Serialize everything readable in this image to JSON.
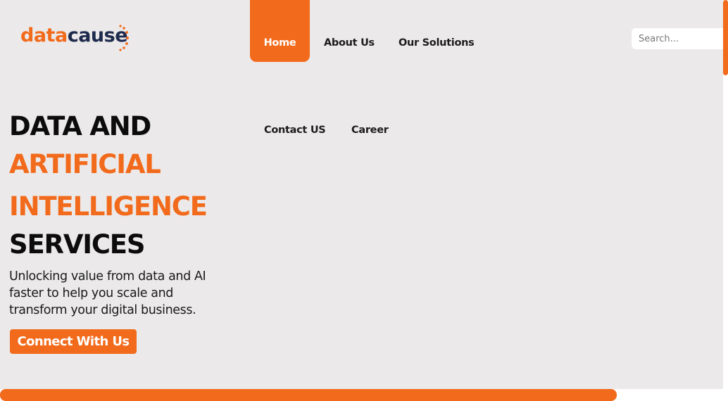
{
  "brand": {
    "logo_part1": "data",
    "logo_part2": "cause",
    "orange": "#f26a1b",
    "navy": "#1f2b4d"
  },
  "nav": {
    "home": "Home",
    "about": "About Us",
    "solutions": "Our Solutions",
    "contact": "Contact US",
    "career": "Career"
  },
  "search": {
    "placeholder": "Search..."
  },
  "hero": {
    "line1": "DATA AND",
    "line2": "ARTIFICIAL",
    "line3": "INTELLIGENCE",
    "line4": "SERVICES",
    "subtitle": "Unlocking value from data and AI faster to help you scale and transform your digital business.",
    "cta": "Connect With Us"
  },
  "colors": {
    "background": "#ebe9e9",
    "accent": "#f26a1b",
    "text": "#0c0c0c"
  }
}
